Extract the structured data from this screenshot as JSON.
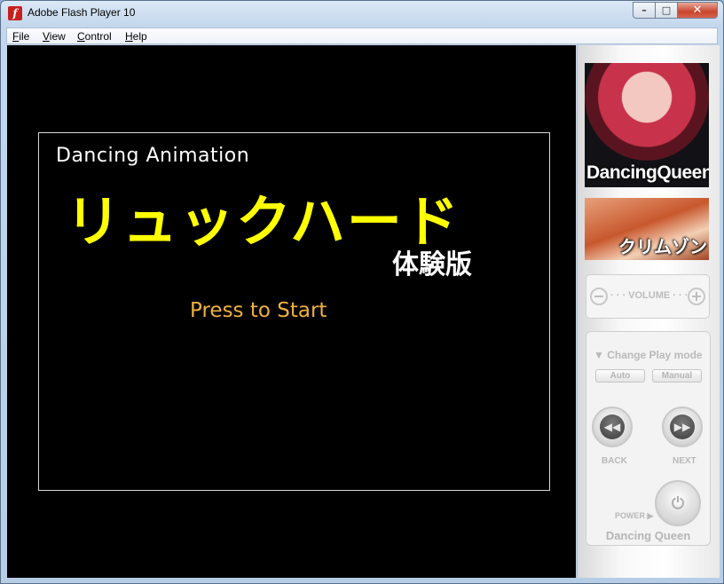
{
  "window": {
    "title": "Adobe Flash Player 10",
    "app_icon_glyph": "f",
    "minimize": "–",
    "maximize": "□",
    "close": "✕"
  },
  "menu": [
    "File",
    "View",
    "Control",
    "Help"
  ],
  "stage": {
    "subtitle": "Dancing Animation",
    "title": "リュックハード",
    "trial": "体験版",
    "press": "Press to Start",
    "title_color": "#ffff00",
    "press_color": "#f0b040"
  },
  "panel": {
    "thumb1_label": "DancingQueen",
    "thumb2_label": "クリムゾン",
    "volume": {
      "label": "· · · VOLUME · · ·",
      "minus": "−",
      "plus": "+"
    },
    "play_mode": {
      "label": "▼ Change Play mode",
      "auto": "Auto",
      "manual": "Manual"
    },
    "back": {
      "glyph": "◀◀",
      "label": "BACK"
    },
    "next": {
      "glyph": "▶▶",
      "label": "NEXT"
    },
    "power": {
      "label": "POWER ▶",
      "glyph": "⏻"
    },
    "brand": "Dancing Queen"
  }
}
